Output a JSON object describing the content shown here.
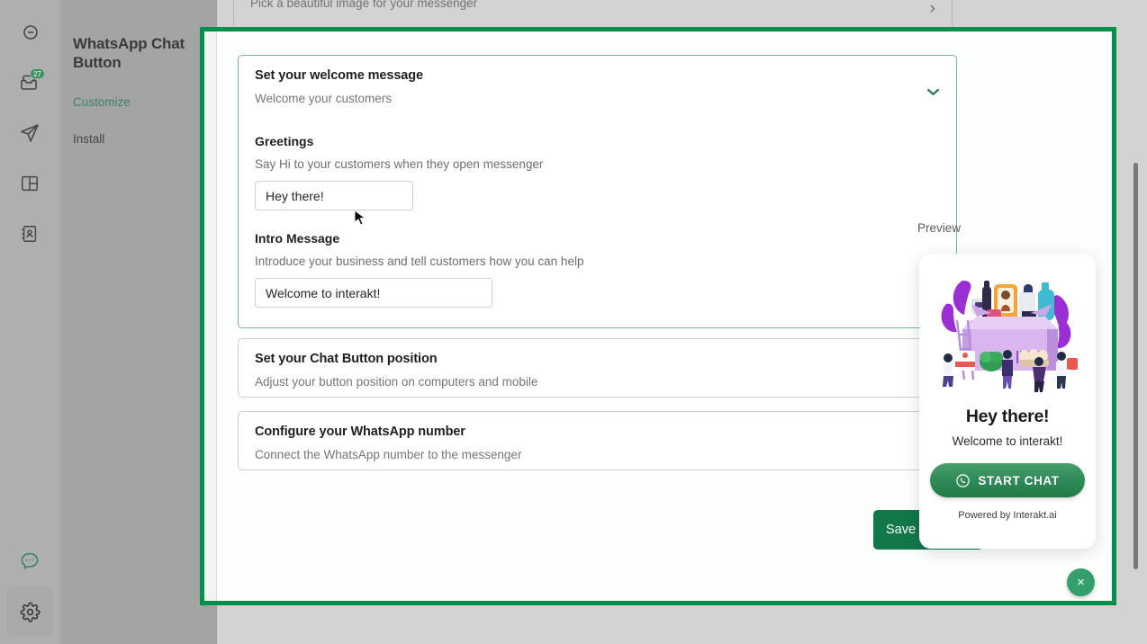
{
  "rail": {
    "items": [
      {
        "name": "brand-logo-icon",
        "badge": null
      },
      {
        "name": "inbox-icon",
        "badge": "27"
      },
      {
        "name": "send-icon",
        "badge": null
      },
      {
        "name": "dashboard-icon",
        "badge": null
      },
      {
        "name": "contacts-icon",
        "badge": null
      }
    ],
    "bottom": [
      {
        "name": "chat-widget-icon"
      },
      {
        "name": "settings-gear-icon"
      }
    ]
  },
  "subnav": {
    "title": "WhatsApp Chat Button",
    "items": [
      {
        "label": "Customize",
        "active": true
      },
      {
        "label": "Install",
        "active": false
      }
    ]
  },
  "clipped_card": {
    "subtitle": "Pick a beautiful image for your messenger"
  },
  "cards": {
    "welcome": {
      "title": "Set your welcome message",
      "subtitle": "Welcome your customers",
      "greetings": {
        "label": "Greetings",
        "help": "Say Hi to your customers when they open messenger",
        "value": "Hey there!"
      },
      "intro": {
        "label": "Intro Message",
        "help": "Introduce your business and tell customers how you can help",
        "value": "Welcome to interakt!"
      }
    },
    "position": {
      "title": "Set your Chat Button position",
      "subtitle": "Adjust your button position on computers and mobile"
    },
    "number": {
      "title": "Configure your WhatsApp number",
      "subtitle": "Connect the WhatsApp number to the messenger"
    }
  },
  "actions": {
    "save_label": "Save Changes"
  },
  "preview": {
    "label": "Preview",
    "heading": "Hey there!",
    "subheading": "Welcome to interakt!",
    "start_chat_label": "START CHAT",
    "powered_by": "Powered by Interakt.ai",
    "close_label": "×"
  },
  "colors": {
    "brand_green": "#03914a",
    "accent_green": "#1f8a5b",
    "save_green": "#11784a",
    "badge_green": "#12a150"
  }
}
